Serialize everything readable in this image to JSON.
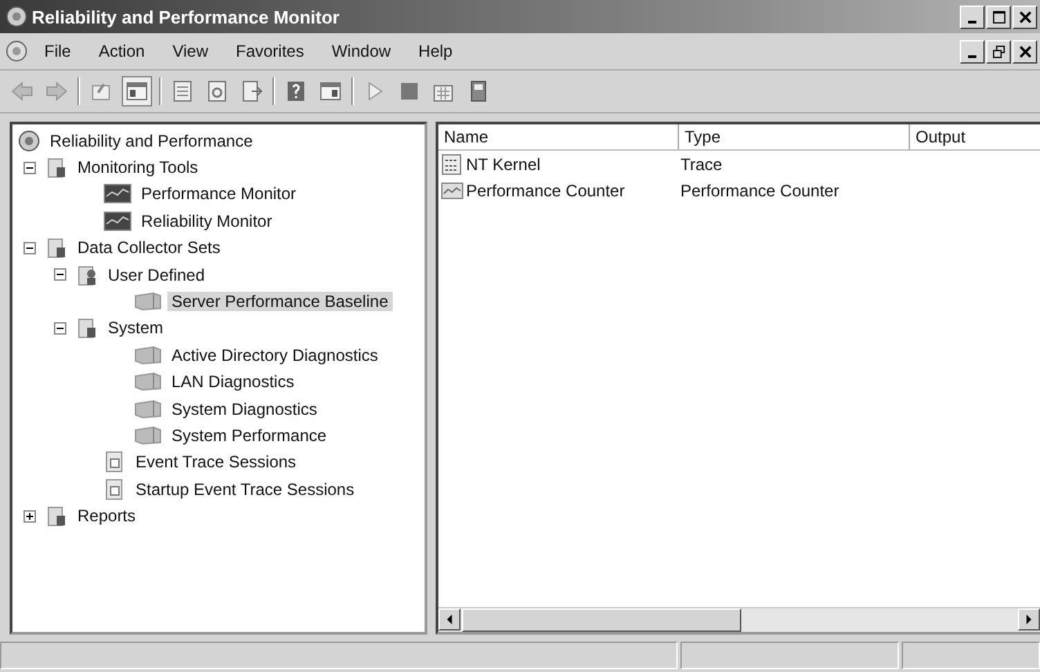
{
  "window": {
    "title": "Reliability and Performance Monitor"
  },
  "menu": [
    "File",
    "Action",
    "View",
    "Favorites",
    "Window",
    "Help"
  ],
  "tree": [
    {
      "label": "Reliability and Performance",
      "kind": "root",
      "selected": false,
      "children": [
        {
          "label": "Monitoring Tools",
          "kind": "folder",
          "selected": false,
          "expanded": true,
          "children": [
            {
              "label": "Performance Monitor",
              "kind": "monitor",
              "selected": false
            },
            {
              "label": "Reliability Monitor",
              "kind": "monitor",
              "selected": false
            }
          ]
        },
        {
          "label": "Data Collector Sets",
          "kind": "folder",
          "selected": false,
          "expanded": true,
          "children": [
            {
              "label": "User Defined",
              "kind": "user",
              "selected": false,
              "expanded": true,
              "children": [
                {
                  "label": "Server Performance Baseline",
                  "kind": "collector",
                  "selected": true
                }
              ]
            },
            {
              "label": "System",
              "kind": "folder",
              "selected": false,
              "expanded": true,
              "children": [
                {
                  "label": "Active Directory Diagnostics",
                  "kind": "collector",
                  "selected": false
                },
                {
                  "label": "LAN Diagnostics",
                  "kind": "collector",
                  "selected": false
                },
                {
                  "label": "System Diagnostics",
                  "kind": "collector",
                  "selected": false
                },
                {
                  "label": "System Performance",
                  "kind": "collector",
                  "selected": false
                }
              ]
            },
            {
              "label": "Event Trace Sessions",
              "kind": "trace",
              "selected": false
            },
            {
              "label": "Startup Event Trace Sessions",
              "kind": "trace",
              "selected": false
            }
          ]
        },
        {
          "label": "Reports",
          "kind": "folder",
          "selected": false,
          "expanded": false
        }
      ]
    }
  ],
  "table": {
    "columns": [
      "Name",
      "Type",
      "Output"
    ],
    "rows": [
      {
        "name": "NT Kernel",
        "type": "Trace",
        "kind": "trace"
      },
      {
        "name": "Performance Counter",
        "type": "Performance Counter",
        "kind": "counter"
      }
    ]
  }
}
